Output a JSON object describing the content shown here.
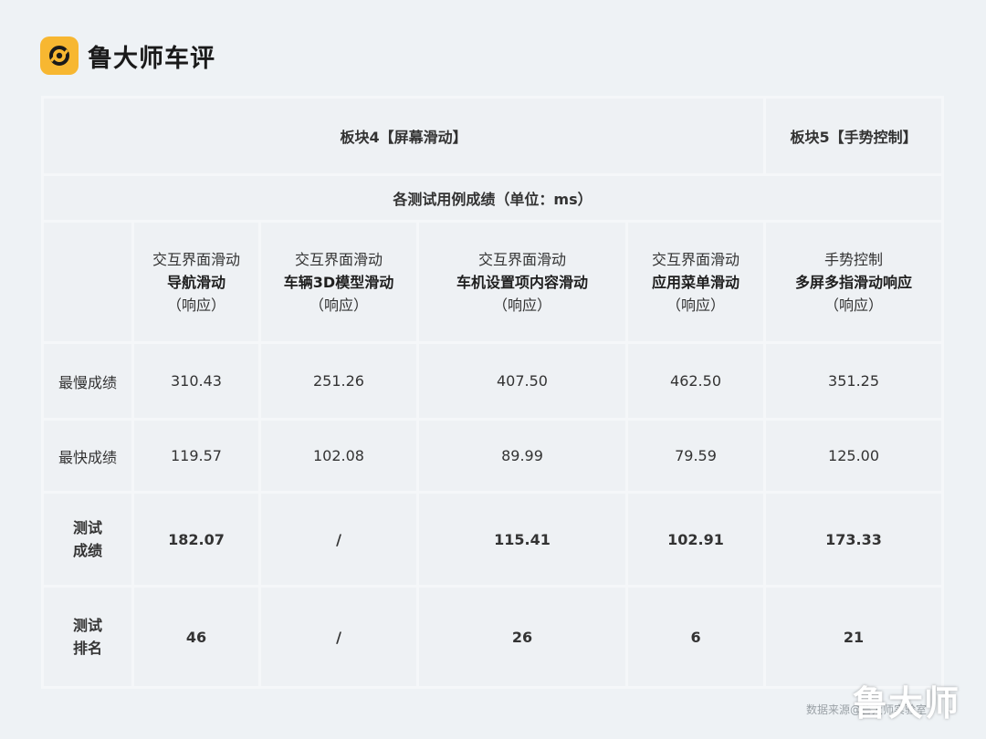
{
  "brand": {
    "name": "鲁大师车评",
    "icon": "brand-logo-icon",
    "accent": "#f7b731"
  },
  "table": {
    "block4_title": "板块4【屏幕滑动】",
    "block5_title": "板块5【手势控制】",
    "subtitle": "各测试用例成绩（单位：ms）",
    "columns": [
      {
        "line1": "交互界面滑动",
        "line2": "导航滑动",
        "line3": "（响应）"
      },
      {
        "line1": "交互界面滑动",
        "line2": "车辆3D模型滑动",
        "line3": "（响应）"
      },
      {
        "line1": "交互界面滑动",
        "line2": "车机设置项内容滑动",
        "line3": "（响应）"
      },
      {
        "line1": "交互界面滑动",
        "line2": "应用菜单滑动",
        "line3": "（响应）"
      },
      {
        "line1": "手势控制",
        "line2": "多屏多指滑动响应",
        "line3": "（响应）"
      }
    ],
    "rows": [
      {
        "label": "最慢成绩",
        "label2": "",
        "values": [
          "310.43",
          "251.26",
          "407.50",
          "462.50",
          "351.25"
        ]
      },
      {
        "label": "最快成绩",
        "label2": "",
        "values": [
          "119.57",
          "102.08",
          "89.99",
          "79.59",
          "125.00"
        ]
      },
      {
        "label": "测试",
        "label2": "成绩",
        "values": [
          "182.07",
          "/",
          "115.41",
          "102.91",
          "173.33"
        ]
      },
      {
        "label": "测试",
        "label2": "排名",
        "values": [
          "46",
          "/",
          "26",
          "6",
          "21"
        ]
      }
    ]
  },
  "footer": {
    "source": "数据来源@鲁大师实验室",
    "watermark": "鲁大师"
  },
  "colors": {
    "header_bg": "#a8dbd9",
    "header_text": "#6d5b34",
    "highlight_text": "#7a6433",
    "cell_bg": "#eef1f4"
  }
}
